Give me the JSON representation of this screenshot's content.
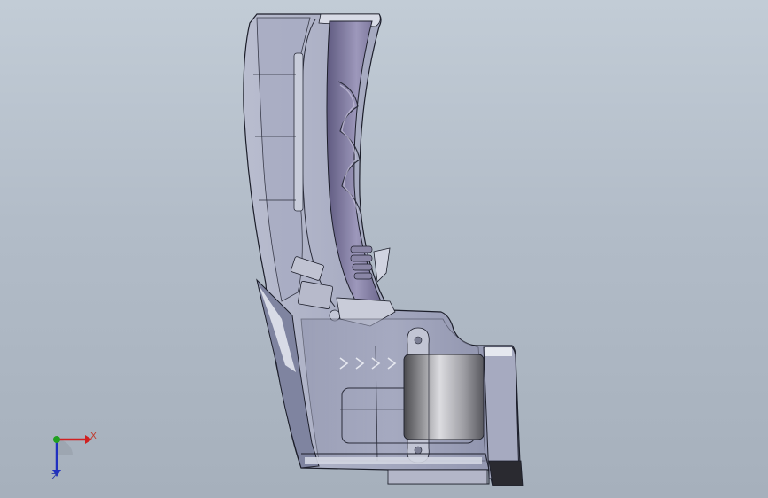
{
  "viewport": {
    "background_top": "#c2ccd6",
    "background_bottom": "#a6b0bc"
  },
  "model": {
    "part_color": "#9a9fb8",
    "edge_color": "#1c1e2a",
    "grip_color": "#7a7698"
  },
  "triad": {
    "x_label": "X",
    "z_label": "Z",
    "x_color": "#d02020",
    "y_color": "#20a020",
    "z_color": "#2030c0"
  }
}
